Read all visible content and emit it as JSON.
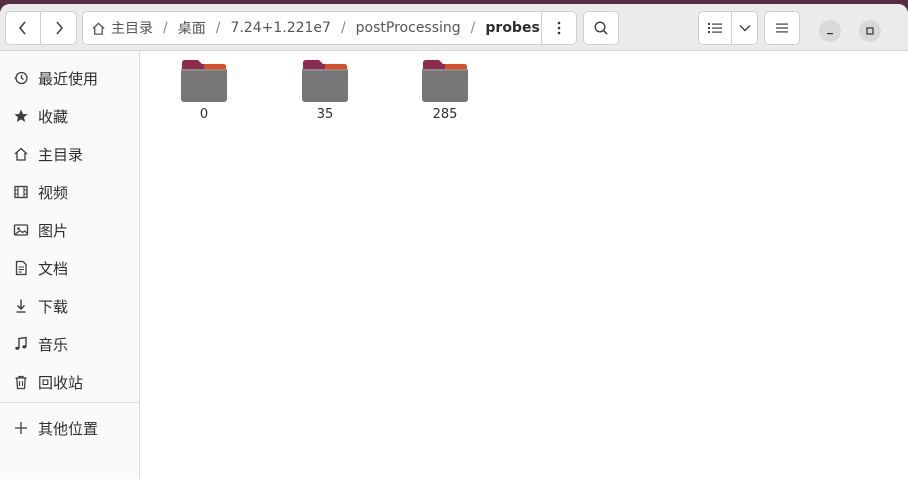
{
  "pathbar": {
    "crumbs": [
      "主目录",
      "桌面",
      "7.24+1.221e7",
      "postProcessing"
    ],
    "current": "probes",
    "separator": "/"
  },
  "sidebar": {
    "items": [
      {
        "label": "最近使用",
        "icon": "clock-icon"
      },
      {
        "label": "收藏",
        "icon": "star-icon"
      },
      {
        "label": "主目录",
        "icon": "home-icon"
      },
      {
        "label": "视频",
        "icon": "video-icon"
      },
      {
        "label": "图片",
        "icon": "image-icon"
      },
      {
        "label": "文档",
        "icon": "document-icon"
      },
      {
        "label": "下载",
        "icon": "download-icon"
      },
      {
        "label": "音乐",
        "icon": "music-icon"
      },
      {
        "label": "回收站",
        "icon": "trash-icon"
      }
    ],
    "other_locations": {
      "label": "其他位置",
      "icon": "plus-icon"
    }
  },
  "folders": [
    {
      "name": "0"
    },
    {
      "name": "35"
    },
    {
      "name": "285"
    }
  ],
  "colors": {
    "accent": "#e95420",
    "folder_tab": "#8c2a4f",
    "folder_body": "#767676",
    "desktop": "#5a2c44"
  }
}
